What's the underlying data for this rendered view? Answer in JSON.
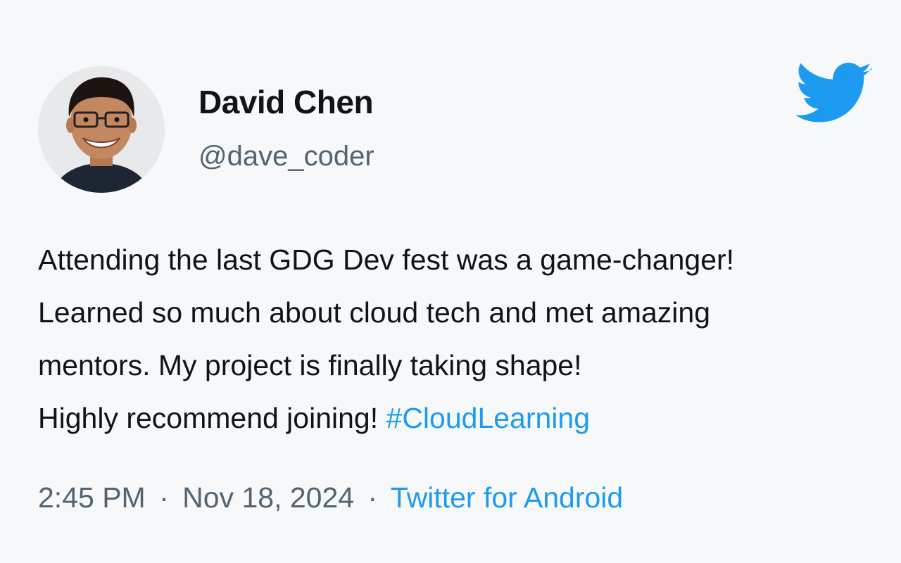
{
  "author": {
    "display_name": "David Chen",
    "handle": "@dave_coder",
    "avatar_icon": "profile-photo"
  },
  "brand": {
    "icon": "twitter-bird-icon",
    "color": "#1d9bf0"
  },
  "tweet": {
    "lines": [
      "Attending the last GDG Dev fest was a game-changer!",
      "Learned so much about cloud tech and met amazing",
      "mentors.  My project is finally taking shape!",
      "Highly recommend joining! "
    ],
    "hashtag": "#CloudLearning"
  },
  "meta": {
    "time": "2:45 PM",
    "separator": "·",
    "date": "Nov 18, 2024",
    "source": "Twitter for Android"
  },
  "colors": {
    "text": "#0f1419",
    "secondary": "#536471",
    "link": "#1d9bf0",
    "background": "#f7f8f9"
  }
}
